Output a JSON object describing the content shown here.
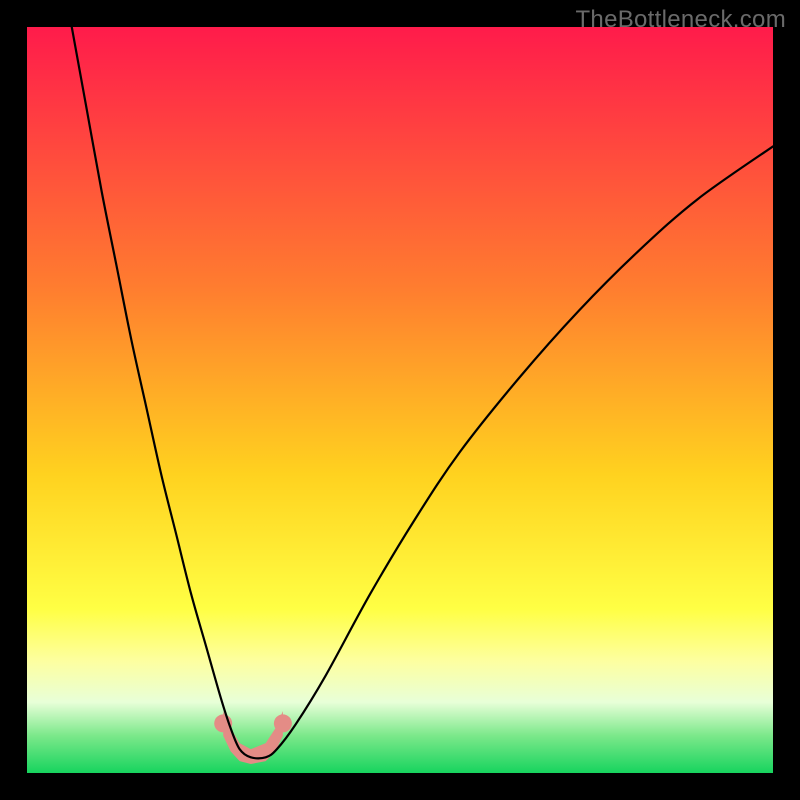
{
  "watermark": "TheBottleneck.com",
  "chart_data": {
    "type": "line",
    "title": "",
    "xlabel": "",
    "ylabel": "",
    "xlim": [
      0,
      100
    ],
    "ylim": [
      0,
      100
    ],
    "grid": false,
    "legend": false,
    "background_gradient": {
      "stops": [
        {
          "offset": 0.0,
          "color": "#ff1b4b"
        },
        {
          "offset": 0.35,
          "color": "#ff7d2f"
        },
        {
          "offset": 0.6,
          "color": "#ffd21f"
        },
        {
          "offset": 0.78,
          "color": "#ffff44"
        },
        {
          "offset": 0.85,
          "color": "#fdffa0"
        },
        {
          "offset": 0.905,
          "color": "#e8ffd8"
        },
        {
          "offset": 0.95,
          "color": "#7be88a"
        },
        {
          "offset": 1.0,
          "color": "#17d45e"
        }
      ]
    },
    "series": [
      {
        "name": "bottleneck-curve",
        "color": "#000000",
        "stroke_width": 2.2,
        "x": [
          6,
          8,
          10,
          12,
          14,
          16,
          18,
          20,
          22,
          24,
          26,
          27.3,
          28.5,
          30,
          32,
          33.5,
          36,
          40,
          46,
          52,
          58,
          66,
          74,
          82,
          90,
          100
        ],
        "y": [
          100,
          89,
          78,
          68,
          58,
          49,
          40,
          32,
          24,
          17,
          10,
          6,
          3.2,
          2.1,
          2.1,
          3.2,
          6.5,
          13,
          24,
          34,
          43,
          53,
          62,
          70,
          77,
          84
        ]
      }
    ],
    "tolerance_band": {
      "name": "acceptable-band",
      "color": "#e48c86",
      "x": [
        26.3,
        27.3,
        28.5,
        30.0,
        32.0,
        33.3,
        34.3
      ],
      "y_low": [
        5.0,
        2.9,
        1.6,
        1.2,
        1.6,
        2.9,
        5.0
      ],
      "y_high": [
        8.3,
        6.0,
        4.0,
        3.2,
        4.0,
        6.0,
        8.3
      ],
      "cap_radius_px": 9
    }
  }
}
